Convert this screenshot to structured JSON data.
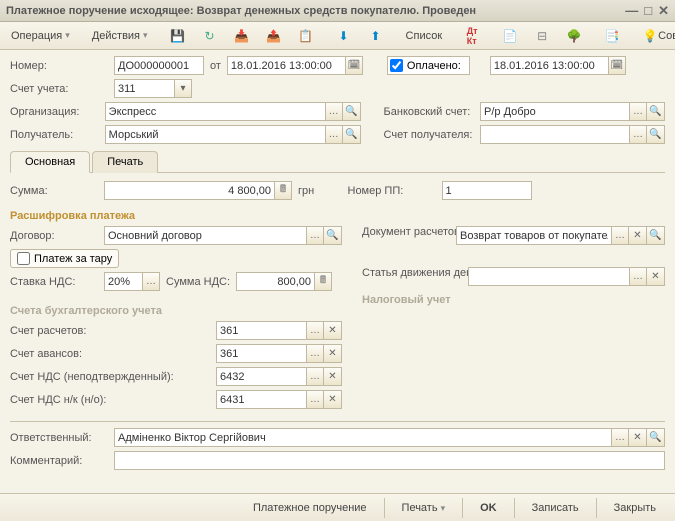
{
  "title": "Платежное поручение исходящее: Возврат денежных средств покупателю. Проведен",
  "toolbar": {
    "operation": "Операция",
    "actions": "Действия",
    "list": "Список",
    "tips": "Советы"
  },
  "number_lbl": "Номер:",
  "number": "ДО000000001",
  "from": "от",
  "date1": "18.01.2016 13:00:00",
  "paid_lbl": "Оплачено:",
  "date2": "18.01.2016 13:00:00",
  "acct_lbl": "Счет учета:",
  "acct": "311",
  "org_lbl": "Организация:",
  "org": "Экспресс",
  "bank_lbl": "Банковский счет:",
  "bank": "Р/р Добро",
  "recv_lbl": "Получатель:",
  "recv": "Морський",
  "recv_acct_lbl": "Счет получателя:",
  "tabs": {
    "main": "Основная",
    "print": "Печать"
  },
  "sum_lbl": "Сумма:",
  "sum": "4 800,00",
  "cur": "грн",
  "pp_lbl": "Номер ПП:",
  "pp": "1",
  "decode_title": "Расшифровка платежа",
  "contract_lbl": "Договор:",
  "contract": "Основний договор",
  "doc_calc_lbl": "Документ расчетов:",
  "doc_calc": "Возврат товаров от покупателя",
  "tare_lbl": "Платеж за тару",
  "vat_rate_lbl": "Ставка НДС:",
  "vat_rate": "20%",
  "vat_sum_lbl": "Сумма НДС:",
  "vat_sum": "800,00",
  "move_lbl": "Статья движения ден. средств:",
  "tax_title": "Налоговый учет",
  "accts_title": "Счета бухгалтерского учета",
  "a1_lbl": "Счет расчетов:",
  "a1": "361",
  "a2_lbl": "Счет авансов:",
  "a2": "361",
  "a3_lbl": "Счет НДС (неподтвержденный):",
  "a3": "6432",
  "a4_lbl": "Счет НДС н/к (н/о):",
  "a4": "6431",
  "resp_lbl": "Ответственный:",
  "resp": "Адміненко Віктор Сергійович",
  "comm_lbl": "Комментарий:",
  "bottom": {
    "po": "Платежное поручение",
    "print": "Печать",
    "ok": "OK",
    "save": "Записать",
    "close": "Закрыть"
  }
}
